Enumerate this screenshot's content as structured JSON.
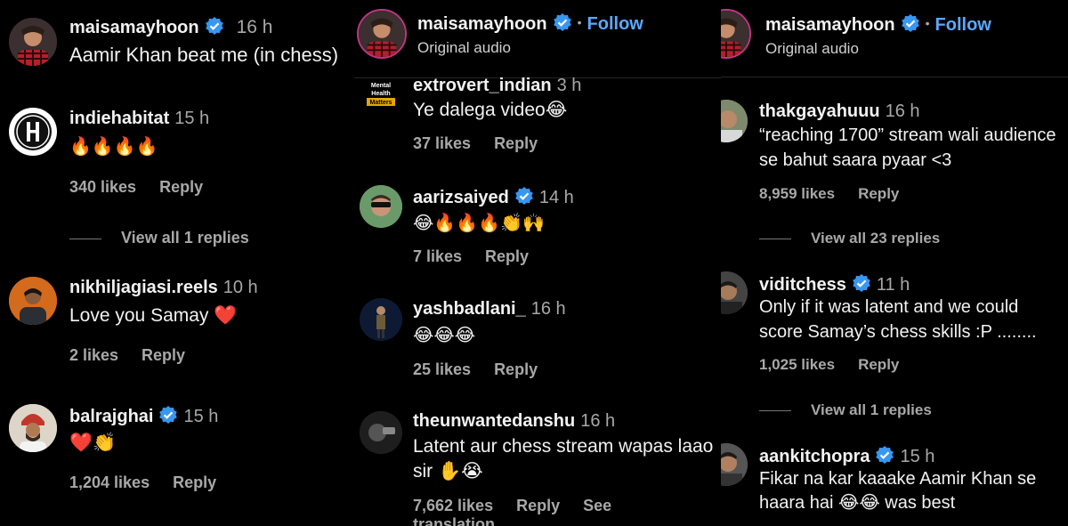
{
  "panel1": {
    "post": {
      "username": "maisamayhoon",
      "time": "16 h",
      "text": "Aamir Khan beat me (in chess)"
    },
    "comments": [
      {
        "username": "indiehabitat",
        "time": "15 h",
        "text": "🔥🔥🔥🔥",
        "likes": "340 likes",
        "reply": "Reply",
        "view_replies": "View all 1 replies"
      },
      {
        "username": "nikhiljagiasi.reels",
        "time": "10 h",
        "text": "Love you Samay ❤️",
        "likes": "2 likes",
        "reply": "Reply"
      },
      {
        "username": "balrajghai",
        "time": "15 h",
        "text": "❤️👏",
        "likes": "1,204 likes",
        "reply": "Reply"
      }
    ]
  },
  "panel2": {
    "header": {
      "username": "maisamayhoon",
      "follow": "Follow",
      "subtitle": "Original audio"
    },
    "comments": [
      {
        "username": "extrovert_indian",
        "time": "3 h",
        "text": "Ye dalega video😂",
        "likes": "37 likes",
        "reply": "Reply",
        "avatar_text": "Mental Health Matters"
      },
      {
        "username": "aarizsaiyed",
        "time": "14 h",
        "text": "😂🔥🔥🔥👏🙌",
        "likes": "7 likes",
        "reply": "Reply"
      },
      {
        "username": "yashbadlani_",
        "time": "16 h",
        "text": "😂😂😂",
        "likes": "25 likes",
        "reply": "Reply"
      },
      {
        "username": "theunwantedanshu",
        "time": "16 h",
        "text_line1": "Latent aur chess stream wapas laao",
        "text_line2": "sir ✋😭",
        "likes": "7,662 likes",
        "reply": "Reply",
        "translate": "See translation"
      }
    ]
  },
  "panel3": {
    "header": {
      "username": "maisamayhoon",
      "follow": "Follow",
      "subtitle": "Original audio"
    },
    "comments": [
      {
        "username": "thakgayahuuu",
        "time": "16 h",
        "text_line1": "“reaching 1700” stream wali audience",
        "text_line2": "se bahut saara pyaar <3",
        "likes": "8,959 likes",
        "reply": "Reply",
        "view_replies": "View all 23 replies"
      },
      {
        "username": "viditchess",
        "time": "11 h",
        "text_line1": "Only if it was latent and we could",
        "text_line2": "score Samay’s chess skills :P ........",
        "likes": "1,025 likes",
        "reply": "Reply",
        "view_replies": "View all 1 replies"
      },
      {
        "username": "aankitchopra",
        "time": "15 h",
        "text_line1": "Fikar na kar kaaake Aamir Khan se",
        "text_line2": "haara hai 😂😂 was best"
      }
    ]
  },
  "colors": {
    "background": "#000000",
    "verified": "#3897f0",
    "follow": "#5aa9ff",
    "muted": "#a8a8a8"
  }
}
